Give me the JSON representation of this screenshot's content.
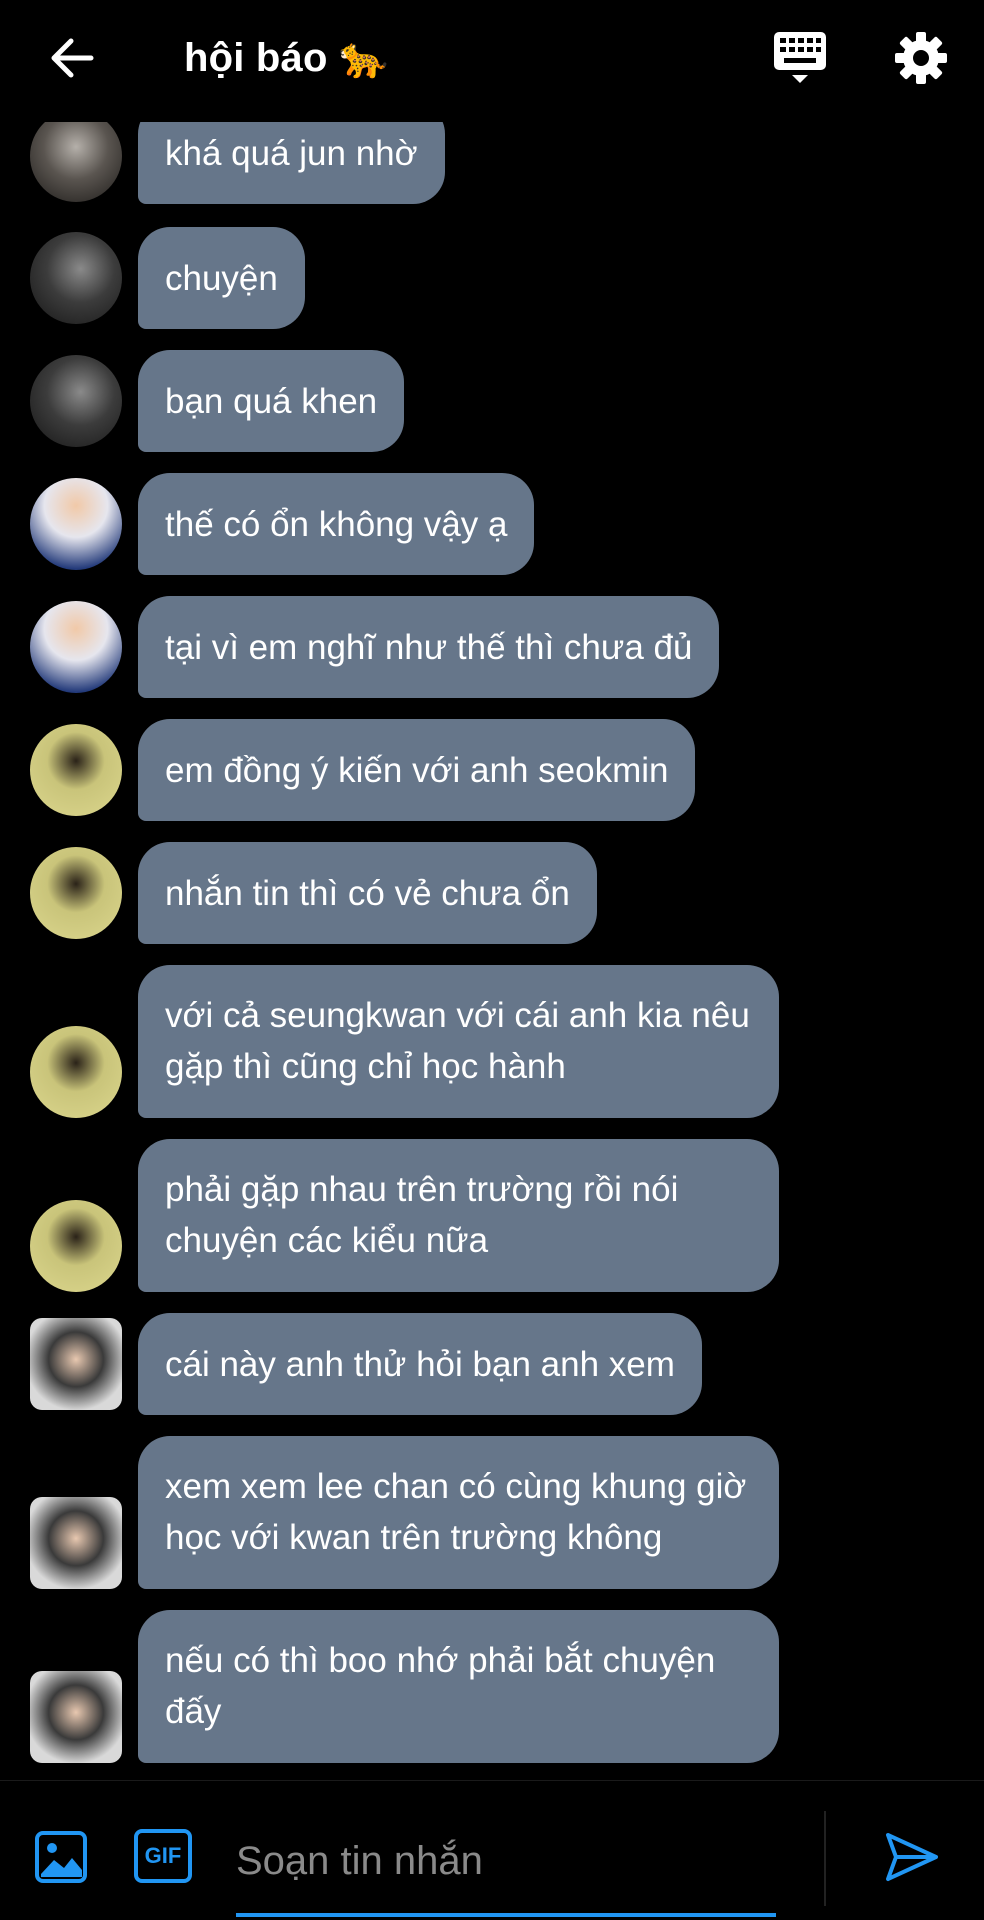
{
  "header": {
    "title": "hội báo 🐆",
    "back_icon": "arrow-left-icon",
    "keyboard_icon": "keyboard-icon",
    "settings_icon": "gear-icon"
  },
  "messages": [
    {
      "text": "khá quá jun nhờ",
      "avatar": "avatar-a"
    },
    {
      "text": "chuyện",
      "avatar": "avatar-b"
    },
    {
      "text": "bạn quá khen",
      "avatar": "avatar-b"
    },
    {
      "text": "thế có ổn không vậy ạ",
      "avatar": "avatar-c"
    },
    {
      "text": "tại vì em nghĩ như thế thì chưa đủ",
      "avatar": "avatar-c"
    },
    {
      "text": "em đồng ý kiến với anh seokmin",
      "avatar": "avatar-d"
    },
    {
      "text": "nhắn tin thì có vẻ chưa ổn",
      "avatar": "avatar-d"
    },
    {
      "text": "với cả seungkwan với cái anh kia nêu gặp thì cũng chỉ học hành",
      "avatar": "avatar-d"
    },
    {
      "text": "phải gặp nhau trên trường rồi nói chuyện các kiểu nữa",
      "avatar": "avatar-d"
    },
    {
      "text": "cái này anh thử hỏi bạn anh xem",
      "avatar": "avatar-e"
    },
    {
      "text": "xem xem lee chan có cùng khung giờ học với kwan trên trường không",
      "avatar": "avatar-e"
    },
    {
      "text": "nếu có thì boo nhớ phải bắt chuyện đấy",
      "avatar": "avatar-e"
    }
  ],
  "composer": {
    "placeholder": "Soạn tin nhắn",
    "gif_label": "GIF",
    "image_icon": "image-icon",
    "send_icon": "send-icon"
  },
  "colors": {
    "background": "#000000",
    "bubble": "#66768a",
    "accent": "#2196f3"
  }
}
